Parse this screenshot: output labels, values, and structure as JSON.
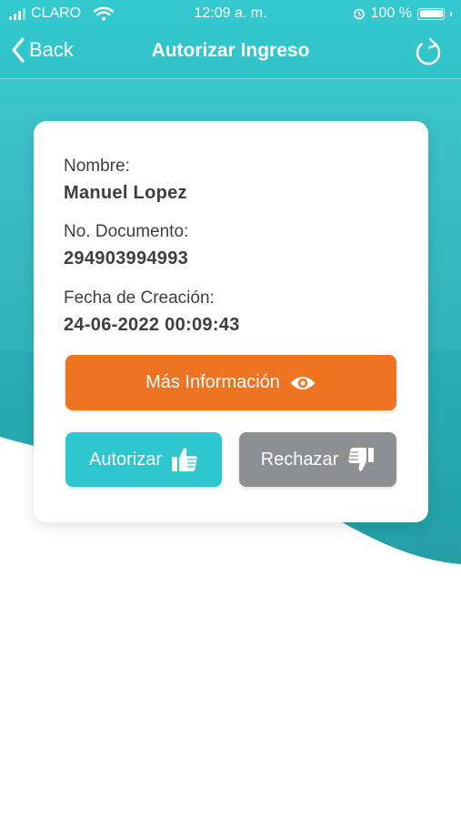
{
  "status_bar": {
    "carrier": "CLARO",
    "time": "12:09 a. m.",
    "battery": "100 %"
  },
  "nav": {
    "back_label": "Back",
    "title": "Autorizar Ingreso"
  },
  "card": {
    "name_label": "Nombre:",
    "name_value": "Manuel Lopez",
    "doc_label": "No. Documento:",
    "doc_value": "294903994993",
    "date_label": "Fecha de Creación:",
    "date_value": "24-06-2022 00:09:43",
    "more_info_label": "Más Información",
    "authorize_label": "Autorizar",
    "reject_label": "Rechazar"
  },
  "colors": {
    "teal": "#2fc7ce",
    "orange": "#ee7421",
    "gray": "#8e8f93",
    "text": "#3e3e3e"
  },
  "icons": {
    "back": "chevron-left-icon",
    "refresh": "refresh-icon",
    "more_info": "eye-icon",
    "authorize": "thumbs-up-icon",
    "reject": "thumbs-down-icon"
  }
}
